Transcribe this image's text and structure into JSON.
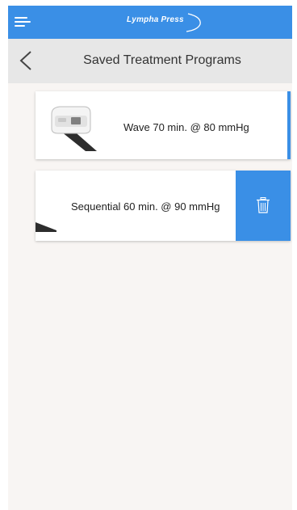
{
  "header": {
    "brand_name": "Lympha Press",
    "menu_icon": "hamburger-menu-icon"
  },
  "subheader": {
    "back_icon": "chevron-left-icon",
    "title": "Saved Treatment Programs"
  },
  "programs": [
    {
      "label": "Wave 70 min. @ 80 mmHg",
      "image": "pump-device-image",
      "selected": true
    },
    {
      "label": "Sequential 60 min. @ 90 mmHg",
      "image": "pump-device-image",
      "swipe_action_icon": "trash-icon"
    }
  ],
  "colors": {
    "accent": "#3a8fe6",
    "background": "#f8f5f3",
    "subheader": "#e7e7e7"
  }
}
